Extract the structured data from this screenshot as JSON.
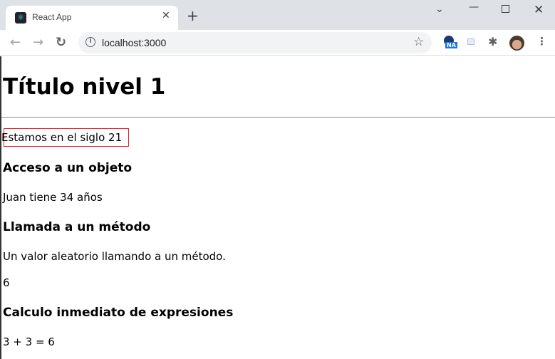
{
  "browser": {
    "tab_title": "React App",
    "tab_close": "✕",
    "new_tab": "+",
    "url": "localhost:3000",
    "extension_badge": "NA",
    "colors": {
      "frame": "#dee1e6",
      "highlight_border": "#e02020"
    }
  },
  "page": {
    "h1": "Título nivel 1",
    "century": "Estamos en el siglo 21",
    "section1_title": "Acceso a un objeto",
    "section1_text": "Juan tiene 34 años",
    "section2_title": "Llamada a un método",
    "section2_text": "Un valor aleatorio llamando a un método.",
    "section2_value": "6",
    "section3_title": "Calculo inmediato de expresiones",
    "section3_text": "3 + 3 = 6"
  }
}
